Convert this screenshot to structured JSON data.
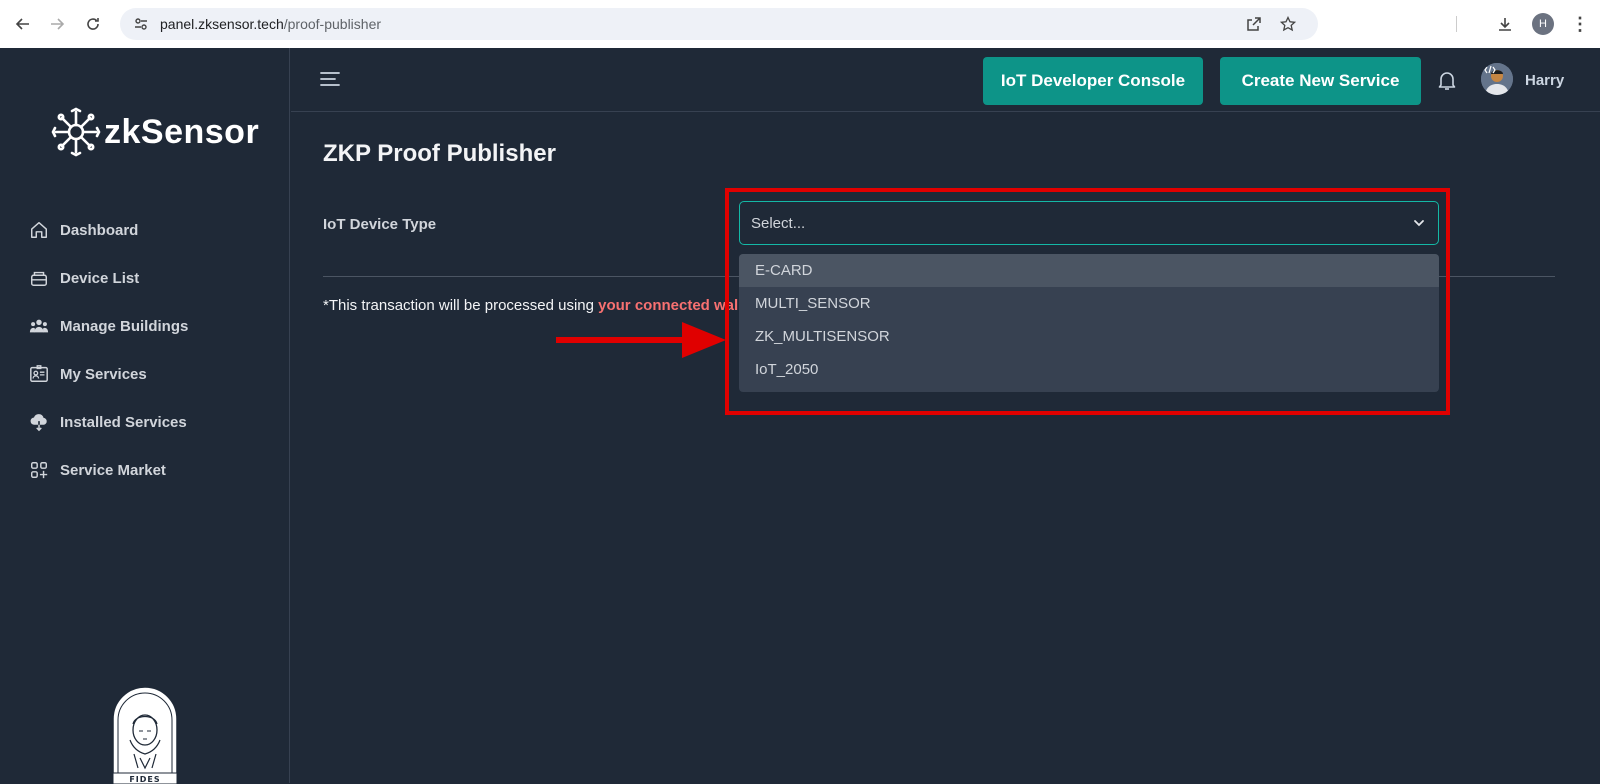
{
  "browser": {
    "url_host": "panel.zksensor.tech",
    "url_path": "/proof-publisher",
    "profile_initial": "H"
  },
  "sidebar": {
    "logo_text": "zkSensor",
    "items": [
      {
        "label": "Dashboard",
        "icon": "home-icon"
      },
      {
        "label": "Device List",
        "icon": "device-icon"
      },
      {
        "label": "Manage Buildings",
        "icon": "users-icon"
      },
      {
        "label": "My Services",
        "icon": "id-card-icon"
      },
      {
        "label": "Installed Services",
        "icon": "cloud-download-icon"
      },
      {
        "label": "Service Market",
        "icon": "apps-add-icon"
      }
    ],
    "footer_logo_text": "FIDES"
  },
  "topbar": {
    "console_button": "IoT Developer Console",
    "create_button": "Create New Service",
    "user_name": "Harry"
  },
  "main": {
    "title": "ZKP Proof Publisher",
    "device_type_label": "IoT Device Type",
    "select_placeholder": "Select...",
    "note_prefix": "*This transaction will be processed using ",
    "note_highlight": "your connected wall",
    "dropdown_options": [
      "E-CARD",
      "MULTI_SENSOR",
      "ZK_MULTISENSOR",
      "IoT_2050"
    ],
    "active_option": "E-CARD"
  },
  "colors": {
    "accent": "#0d9488",
    "annotation": "#e00000",
    "background": "#1f2937"
  }
}
